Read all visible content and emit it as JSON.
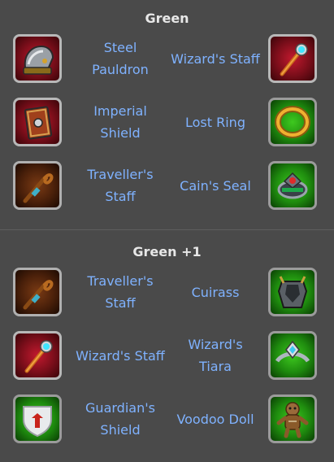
{
  "sections": [
    {
      "title": "Green",
      "rows": [
        {
          "left": {
            "name": "Steel\nPauldron",
            "icon": "steel-pauldron-icon",
            "bg": "red"
          },
          "right": {
            "name": "Wizard's Staff",
            "icon": "wizards-staff-icon",
            "bg": "red"
          }
        },
        {
          "left": {
            "name": "Imperial\nShield",
            "icon": "imperial-shield-icon",
            "bg": "red"
          },
          "right": {
            "name": "Lost Ring",
            "icon": "lost-ring-icon",
            "bg": "green"
          }
        },
        {
          "left": {
            "name": "Traveller's\nStaff",
            "icon": "travellers-staff-icon",
            "bg": "brown"
          },
          "right": {
            "name": "Cain's Seal",
            "icon": "cains-seal-icon",
            "bg": "green"
          }
        }
      ]
    },
    {
      "title": "Green +1",
      "rows": [
        {
          "left": {
            "name": "Traveller's\nStaff",
            "icon": "travellers-staff-icon",
            "bg": "brown"
          },
          "right": {
            "name": "Cuirass",
            "icon": "cuirass-icon",
            "bg": "green"
          }
        },
        {
          "left": {
            "name": "Wizard's Staff",
            "icon": "wizards-staff-icon",
            "bg": "red"
          },
          "right": {
            "name": "Wizard's\nTiara",
            "icon": "wizards-tiara-icon",
            "bg": "green"
          }
        },
        {
          "left": {
            "name": "Guardian's\nShield",
            "icon": "guardians-shield-icon",
            "bg": "green"
          },
          "right": {
            "name": "Voodoo Doll",
            "icon": "voodoo-doll-icon",
            "bg": "green"
          }
        }
      ]
    }
  ],
  "colors": {
    "background": "#4a4a4a",
    "item_text": "#7fb2ff",
    "title_text": "#e8e8e8"
  }
}
